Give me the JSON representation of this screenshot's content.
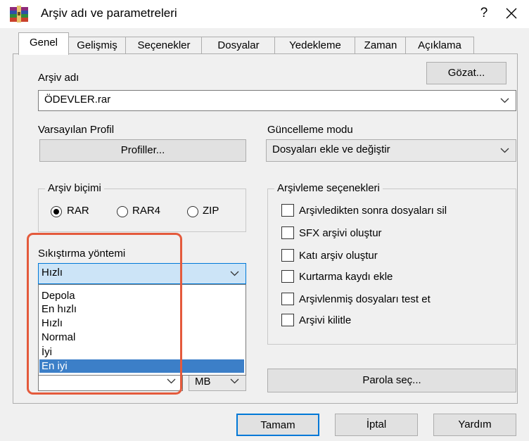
{
  "window": {
    "title": "Arşiv adı ve parametreleri",
    "help": "?",
    "close": "✕"
  },
  "tabs": [
    "Genel",
    "Gelişmiş",
    "Seçenekler",
    "Dosyalar",
    "Yedekleme",
    "Zaman",
    "Açıklama"
  ],
  "archive_name": {
    "label": "Arşiv adı",
    "value": "ÖDEVLER.rar",
    "browse": "Gözat..."
  },
  "profile": {
    "label": "Varsayılan Profil",
    "button": "Profiller..."
  },
  "update_mode": {
    "label": "Güncelleme modu",
    "value": "Dosyaları ekle ve değiştir"
  },
  "format": {
    "label": "Arşiv biçimi",
    "options": [
      "RAR",
      "RAR4",
      "ZIP"
    ],
    "selected": "RAR"
  },
  "compression": {
    "label": "Sıkıştırma yöntemi",
    "value": "Hızlı",
    "options": [
      "Depola",
      "En hızlı",
      "Hızlı",
      "Normal",
      "İyi",
      "En iyi"
    ],
    "highlighted": "En iyi"
  },
  "split": {
    "unit": "MB"
  },
  "archiving_options": {
    "label": "Arşivleme seçenekleri",
    "items": [
      "Arşivledikten sonra dosyaları sil",
      "SFX arşivi oluştur",
      "Katı arşiv oluştur",
      "Kurtarma kaydı ekle",
      "Arşivlenmiş dosyaları test et",
      "Arşivi kilitle"
    ]
  },
  "password_button": "Parola seç...",
  "footer": {
    "ok": "Tamam",
    "cancel": "İptal",
    "help": "Yardım"
  },
  "colors": {
    "highlight_border": "#e45a3c",
    "selection": "#3c7fc8"
  }
}
